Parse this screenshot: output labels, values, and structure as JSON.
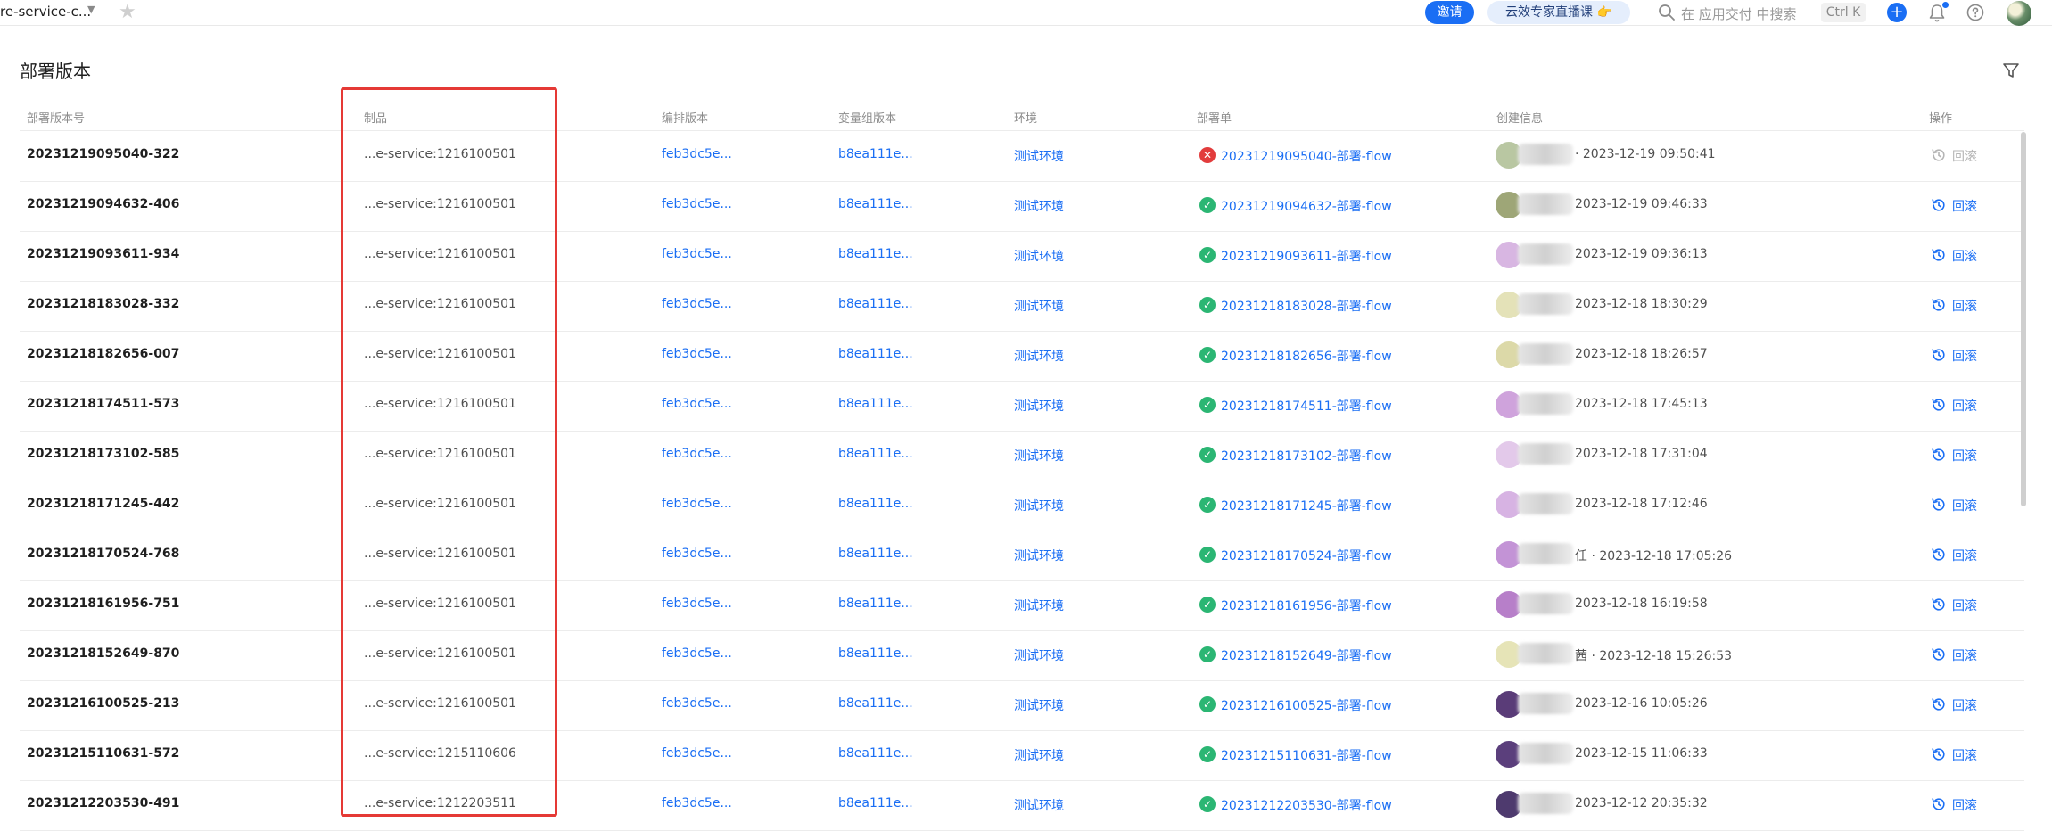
{
  "topbar": {
    "app_title": "re-service-c...",
    "invite": "邀请",
    "expert": "云效专家直播课 👉",
    "search_placeholder": "在 应用交付 中搜索",
    "shortcut": "Ctrl K",
    "plus": "+"
  },
  "page": {
    "title": "部署版本"
  },
  "columns": {
    "version": "部署版本号",
    "artifact": "制品",
    "orchestration": "编排版本",
    "vargroup": "变量组版本",
    "env": "环境",
    "deploy": "部署单",
    "created": "创建信息",
    "action": "操作"
  },
  "colors": {
    "primary": "#1a6ef4",
    "success": "#2bb673",
    "error": "#e23c3c",
    "highlight": "#e53935"
  },
  "rows": [
    {
      "version": "20231219095040-322",
      "artifact": "...e-service:1216100501",
      "orch": "feb3dc5e...",
      "vg": "b8ea111e...",
      "env": "测试环境",
      "deploy": "20231219095040-部署-flow",
      "status": "fail",
      "created": "· 2023-12-19 09:50:41",
      "action": "回滚",
      "action_enabled": false,
      "avatar": "#b9c7a2"
    },
    {
      "version": "20231219094632-406",
      "artifact": "...e-service:1216100501",
      "orch": "feb3dc5e...",
      "vg": "b8ea111e...",
      "env": "测试环境",
      "deploy": "20231219094632-部署-flow",
      "status": "success",
      "created": "2023-12-19 09:46:33",
      "action": "回滚",
      "action_enabled": true,
      "avatar": "#9ea677"
    },
    {
      "version": "20231219093611-934",
      "artifact": "...e-service:1216100501",
      "orch": "feb3dc5e...",
      "vg": "b8ea111e...",
      "env": "测试环境",
      "deploy": "20231219093611-部署-flow",
      "status": "success",
      "created": "2023-12-19 09:36:13",
      "action": "回滚",
      "action_enabled": true,
      "avatar": "#d8b6e2"
    },
    {
      "version": "20231218183028-332",
      "artifact": "...e-service:1216100501",
      "orch": "feb3dc5e...",
      "vg": "b8ea111e...",
      "env": "测试环境",
      "deploy": "20231218183028-部署-flow",
      "status": "success",
      "created": "2023-12-18 18:30:29",
      "action": "回滚",
      "action_enabled": true,
      "avatar": "#e4e2b8"
    },
    {
      "version": "20231218182656-007",
      "artifact": "...e-service:1216100501",
      "orch": "feb3dc5e...",
      "vg": "b8ea111e...",
      "env": "测试环境",
      "deploy": "20231218182656-部署-flow",
      "status": "success",
      "created": "2023-12-18 18:26:57",
      "action": "回滚",
      "action_enabled": true,
      "avatar": "#dcd9a8"
    },
    {
      "version": "20231218174511-573",
      "artifact": "...e-service:1216100501",
      "orch": "feb3dc5e...",
      "vg": "b8ea111e...",
      "env": "测试环境",
      "deploy": "20231218174511-部署-flow",
      "status": "success",
      "created": "2023-12-18 17:45:13",
      "action": "回滚",
      "action_enabled": true,
      "avatar": "#cfa3dc"
    },
    {
      "version": "20231218173102-585",
      "artifact": "...e-service:1216100501",
      "orch": "feb3dc5e...",
      "vg": "b8ea111e...",
      "env": "测试环境",
      "deploy": "20231218173102-部署-flow",
      "status": "success",
      "created": "2023-12-18 17:31:04",
      "action": "回滚",
      "action_enabled": true,
      "avatar": "#e3c9ea"
    },
    {
      "version": "20231218171245-442",
      "artifact": "...e-service:1216100501",
      "orch": "feb3dc5e...",
      "vg": "b8ea111e...",
      "env": "测试环境",
      "deploy": "20231218171245-部署-flow",
      "status": "success",
      "created": "2023-12-18 17:12:46",
      "action": "回滚",
      "action_enabled": true,
      "avatar": "#d7b3e3"
    },
    {
      "version": "20231218170524-768",
      "artifact": "...e-service:1216100501",
      "orch": "feb3dc5e...",
      "vg": "b8ea111e...",
      "env": "测试环境",
      "deploy": "20231218170524-部署-flow",
      "status": "success",
      "created": "任 · 2023-12-18 17:05:26",
      "action": "回滚",
      "action_enabled": true,
      "avatar": "#c393d6"
    },
    {
      "version": "20231218161956-751",
      "artifact": "...e-service:1216100501",
      "orch": "feb3dc5e...",
      "vg": "b8ea111e...",
      "env": "测试环境",
      "deploy": "20231218161956-部署-flow",
      "status": "success",
      "created": "2023-12-18 16:19:58",
      "action": "回滚",
      "action_enabled": true,
      "avatar": "#b77fc9"
    },
    {
      "version": "20231218152649-870",
      "artifact": "...e-service:1216100501",
      "orch": "feb3dc5e...",
      "vg": "b8ea111e...",
      "env": "测试环境",
      "deploy": "20231218152649-部署-flow",
      "status": "success",
      "created": "茜 · 2023-12-18 15:26:53",
      "action": "回滚",
      "action_enabled": true,
      "avatar": "#e6e4b7"
    },
    {
      "version": "20231216100525-213",
      "artifact": "...e-service:1216100501",
      "orch": "feb3dc5e...",
      "vg": "b8ea111e...",
      "env": "测试环境",
      "deploy": "20231216100525-部署-flow",
      "status": "success",
      "created": "2023-12-16 10:05:26",
      "action": "回滚",
      "action_enabled": true,
      "avatar": "#5a3c78"
    },
    {
      "version": "20231215110631-572",
      "artifact": "...e-service:1215110606",
      "orch": "feb3dc5e...",
      "vg": "b8ea111e...",
      "env": "测试环境",
      "deploy": "20231215110631-部署-flow",
      "status": "success",
      "created": "2023-12-15 11:06:33",
      "action": "回滚",
      "action_enabled": true,
      "avatar": "#5b3f7c"
    },
    {
      "version": "20231212203530-491",
      "artifact": "...e-service:1212203511",
      "orch": "feb3dc5e...",
      "vg": "b8ea111e...",
      "env": "测试环境",
      "deploy": "20231212203530-部署-flow",
      "status": "success",
      "created": "2023-12-12 20:35:32",
      "action": "回滚",
      "action_enabled": true,
      "avatar": "#4e3a6e"
    }
  ]
}
